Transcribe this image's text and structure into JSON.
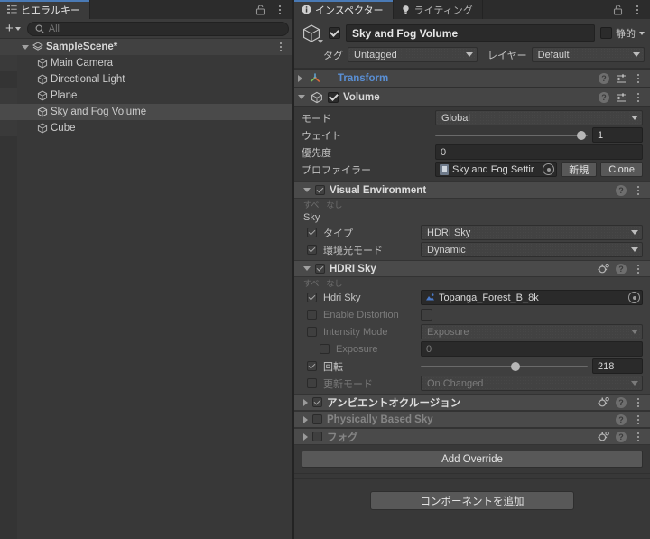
{
  "hierarchy": {
    "tab": {
      "label": "ヒエラルキー",
      "icon": "hierarchy-icon"
    },
    "lock_icon": "lock-icon",
    "menu_icon": "kebab-menu-icon",
    "toolbar": {
      "add_label": "+",
      "add_caret": "▾",
      "search_placeholder": "All",
      "search_icon": "search-icon"
    },
    "items": [
      {
        "label": "SampleScene*",
        "depth": 0,
        "type": "scene",
        "expanded": true,
        "selected": false
      },
      {
        "label": "Main Camera",
        "depth": 1,
        "type": "gameobject",
        "selected": false
      },
      {
        "label": "Directional Light",
        "depth": 1,
        "type": "gameobject",
        "selected": false
      },
      {
        "label": "Plane",
        "depth": 1,
        "type": "gameobject",
        "selected": false
      },
      {
        "label": "Sky and Fog Volume",
        "depth": 1,
        "type": "gameobject",
        "selected": true
      },
      {
        "label": "Cube",
        "depth": 1,
        "type": "gameobject",
        "selected": false
      }
    ]
  },
  "inspector": {
    "tabs": [
      {
        "label": "インスペクター",
        "icon": "info-icon",
        "active": true
      },
      {
        "label": "ライティング",
        "icon": "lightbulb-icon",
        "active": false
      }
    ],
    "lock_icon": "lock-icon",
    "menu_icon": "kebab-menu-icon",
    "gameobject": {
      "enabled": true,
      "name": "Sky and Fog Volume",
      "static_label": "静的",
      "static_checked": false,
      "tag_label": "タグ",
      "tag_value": "Untagged",
      "layer_label": "レイヤー",
      "layer_value": "Default"
    },
    "components": [
      {
        "name": "Transform",
        "expanded": false,
        "has_checkbox": false,
        "link": true
      },
      {
        "name": "Volume",
        "expanded": true,
        "has_checkbox": true,
        "checked": true,
        "link": false
      }
    ],
    "volume": {
      "mode_label": "モード",
      "mode_value": "Global",
      "weight_label": "ウェイト",
      "weight_value": "1",
      "weight_pct": 96,
      "priority_label": "優先度",
      "priority_value": "0",
      "profile_label": "プロファイラー",
      "profile_value": "Sky and Fog Settir",
      "profile_new_button": "新規",
      "profile_clone_button": "Clone"
    },
    "overrides": [
      {
        "title": "Visual Environment",
        "expanded": true,
        "checked": true,
        "dim": false,
        "has_anim_icon": false,
        "all_label": "すべ",
        "none_label": "なし",
        "group_label": "Sky",
        "props": [
          {
            "label": "タイプ",
            "checked": true,
            "dim": false,
            "control": "dropdown",
            "value": "HDRI Sky"
          },
          {
            "label": "環境光モード",
            "checked": true,
            "dim": false,
            "control": "dropdown",
            "value": "Dynamic"
          }
        ]
      },
      {
        "title": "HDRI Sky",
        "expanded": true,
        "checked": true,
        "dim": false,
        "has_anim_icon": true,
        "all_label": "すべ",
        "none_label": "なし",
        "group_label": "",
        "props": [
          {
            "label": "Hdri Sky",
            "checked": true,
            "dim": false,
            "control": "object",
            "value": "Topanga_Forest_B_8k"
          },
          {
            "label": "Enable Distortion",
            "checked": false,
            "dim": true,
            "control": "checkbox",
            "value": ""
          },
          {
            "label": "Intensity Mode",
            "checked": false,
            "dim": true,
            "control": "dropdown",
            "value": "Exposure"
          },
          {
            "label": "Exposure",
            "checked": false,
            "dim": true,
            "control": "field",
            "value": "0",
            "indent": true
          },
          {
            "label": "回転",
            "checked": true,
            "dim": false,
            "control": "slider",
            "value": "218",
            "slider_pct": 57
          },
          {
            "label": "更新モード",
            "checked": false,
            "dim": true,
            "control": "dropdown",
            "value": "On Changed"
          }
        ]
      }
    ],
    "collapsed_overrides": [
      {
        "title": "アンビエントオクルージョン",
        "checked": true,
        "dim": false,
        "has_anim_icon": true
      },
      {
        "title": "Physically Based Sky",
        "checked": false,
        "dim": true,
        "has_anim_icon": false
      },
      {
        "title": "フォグ",
        "checked": false,
        "dim": true,
        "has_anim_icon": true
      }
    ],
    "add_override_button": "Add Override",
    "add_component_button": "コンポーネントを追加"
  },
  "colors": {
    "accent_tab": "#4a7ab5",
    "link_text": "#5a8fd4",
    "panel_bg": "#383838",
    "header_bg": "#454545",
    "selection": "#4a4a4a"
  }
}
